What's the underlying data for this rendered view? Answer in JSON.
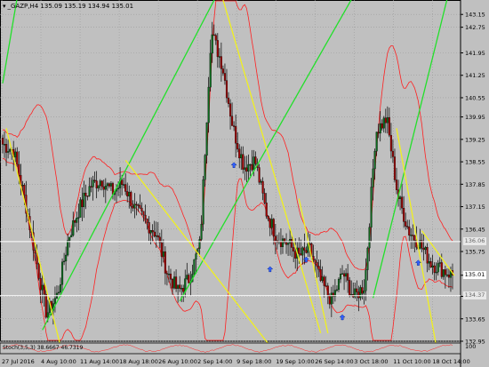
{
  "window": {
    "symbol_line": "_GAZP,H4  135.09 135.19 134.94 135.01"
  },
  "subwindow": {
    "label": "Stoch(3,5,3) 38.6667 46.7319",
    "scale_max": "100"
  },
  "colors": {
    "background": "#c0c0c0",
    "grid": "#9a9a9a",
    "axis_text": "#000000",
    "bull": "#0b6b1e",
    "bear": "#a00000",
    "band": "#ff2020",
    "trend_up": "#22e02a",
    "trend_down": "#f0f020",
    "level_line": "#ffffff",
    "fractal_up": "#3060ff",
    "current_price_bg": "#ffffff",
    "ref_price_bg": "#e8e8e8"
  },
  "price_axis": {
    "ticks": [
      "143.15",
      "142.75",
      "141.95",
      "141.25",
      "140.55",
      "139.95",
      "139.25",
      "138.55",
      "137.85",
      "137.15",
      "136.45",
      "135.75",
      "135.01",
      "134.35",
      "133.65",
      "132.95"
    ],
    "current_price": "135.01",
    "ref_price_upper": "136.06",
    "ref_price_lower": "134.37"
  },
  "time_axis": {
    "labels": [
      "27 Jul 2016",
      "4 Aug 10:00",
      "11 Aug 14:00",
      "18 Aug 18:00",
      "26 Aug 10:00",
      "2 Sep 14:00",
      "9 Sep 18:00",
      "19 Sep 10:00",
      "26 Sep 14:00",
      "3 Oct 18:00",
      "11 Oct 10:00",
      "18 Oct 14:00"
    ]
  },
  "chart_data": {
    "type": "candlestick",
    "symbol": "_GAZP",
    "timeframe": "H4",
    "ohlc_last": {
      "open": 135.09,
      "high": 135.19,
      "low": 134.94,
      "close": 135.01
    },
    "ylim": [
      132.95,
      143.6
    ],
    "close_path": [
      139.1,
      138.9,
      137.4,
      135.6,
      133.8,
      134.4,
      136.2,
      137.1,
      137.8,
      138.0,
      137.6,
      137.9,
      137.1,
      136.7,
      136.3,
      135.1,
      134.5,
      134.9,
      136.0,
      142.6,
      141.6,
      139.6,
      138.4,
      138.6,
      137.0,
      136.2,
      136.0,
      135.6,
      135.8,
      134.8,
      134.2,
      135.1,
      134.3,
      134.7,
      139.5,
      139.9,
      137.5,
      136.4,
      136.0,
      135.4,
      135.2,
      135.01
    ],
    "indicator": {
      "name": "Stoch",
      "params": "3,5,3",
      "main": 38.6667,
      "signal": 46.7319
    }
  }
}
